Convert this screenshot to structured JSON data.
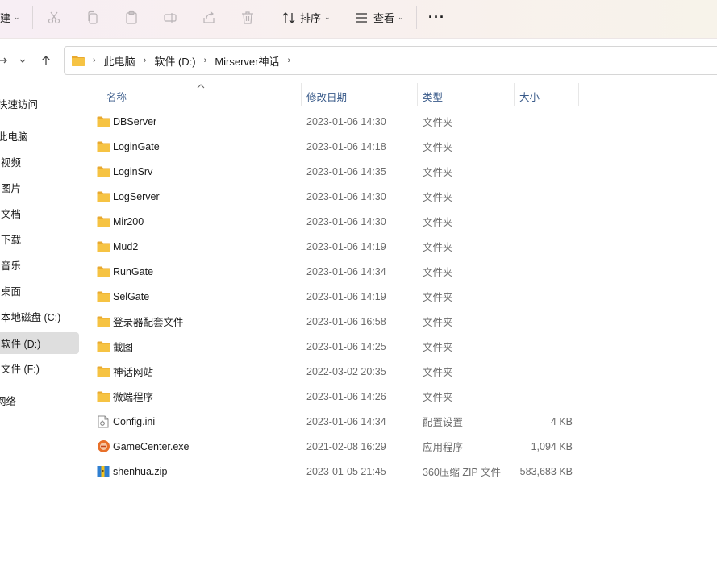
{
  "toolbar": {
    "new_label": "建",
    "sort_label": "排序",
    "view_label": "查看",
    "more_label": "···"
  },
  "address": {
    "crumbs": [
      "此电脑",
      "软件 (D:)",
      "Mirserver神话"
    ]
  },
  "sidebar": {
    "items": [
      {
        "label": "快速访问",
        "selected": false
      },
      {
        "label": "此电脑",
        "selected": false
      },
      {
        "label": "视频",
        "selected": false
      },
      {
        "label": "图片",
        "selected": false
      },
      {
        "label": "文档",
        "selected": false
      },
      {
        "label": "下载",
        "selected": false
      },
      {
        "label": "音乐",
        "selected": false
      },
      {
        "label": "桌面",
        "selected": false
      },
      {
        "label": "本地磁盘 (C:)",
        "selected": false
      },
      {
        "label": "软件 (D:)",
        "selected": true
      },
      {
        "label": "文件 (F:)",
        "selected": false
      },
      {
        "label": "网络",
        "selected": false
      }
    ]
  },
  "columns": {
    "name": "名称",
    "date": "修改日期",
    "type": "类型",
    "size": "大小"
  },
  "files": [
    {
      "name": "DBServer",
      "date": "2023-01-06 14:30",
      "type": "文件夹",
      "size": "",
      "icon": "folder-icon"
    },
    {
      "name": "LoginGate",
      "date": "2023-01-06 14:18",
      "type": "文件夹",
      "size": "",
      "icon": "folder-icon"
    },
    {
      "name": "LoginSrv",
      "date": "2023-01-06 14:35",
      "type": "文件夹",
      "size": "",
      "icon": "folder-icon"
    },
    {
      "name": "LogServer",
      "date": "2023-01-06 14:30",
      "type": "文件夹",
      "size": "",
      "icon": "folder-icon"
    },
    {
      "name": "Mir200",
      "date": "2023-01-06 14:30",
      "type": "文件夹",
      "size": "",
      "icon": "folder-icon"
    },
    {
      "name": "Mud2",
      "date": "2023-01-06 14:19",
      "type": "文件夹",
      "size": "",
      "icon": "folder-icon"
    },
    {
      "name": "RunGate",
      "date": "2023-01-06 14:34",
      "type": "文件夹",
      "size": "",
      "icon": "folder-icon"
    },
    {
      "name": "SelGate",
      "date": "2023-01-06 14:19",
      "type": "文件夹",
      "size": "",
      "icon": "folder-icon"
    },
    {
      "name": "登录器配套文件",
      "date": "2023-01-06 16:58",
      "type": "文件夹",
      "size": "",
      "icon": "folder-icon"
    },
    {
      "name": "截图",
      "date": "2023-01-06 14:25",
      "type": "文件夹",
      "size": "",
      "icon": "folder-icon"
    },
    {
      "name": "神话网站",
      "date": "2022-03-02 20:35",
      "type": "文件夹",
      "size": "",
      "icon": "folder-icon"
    },
    {
      "name": "微端程序",
      "date": "2023-01-06 14:26",
      "type": "文件夹",
      "size": "",
      "icon": "folder-icon"
    },
    {
      "name": "Config.ini",
      "date": "2023-01-06 14:34",
      "type": "配置设置",
      "size": "4 KB",
      "icon": "ini-file-icon"
    },
    {
      "name": "GameCenter.exe",
      "date": "2021-02-08 16:29",
      "type": "应用程序",
      "size": "1,094 KB",
      "icon": "exe-app-icon"
    },
    {
      "name": "shenhua.zip",
      "date": "2023-01-05 21:45",
      "type": "360压缩 ZIP 文件",
      "size": "583,683 KB",
      "icon": "zip-archive-icon"
    }
  ],
  "colors": {
    "folder": "#f6c343",
    "selected_bg": "#dedede",
    "header_text": "#3a5b8a"
  }
}
